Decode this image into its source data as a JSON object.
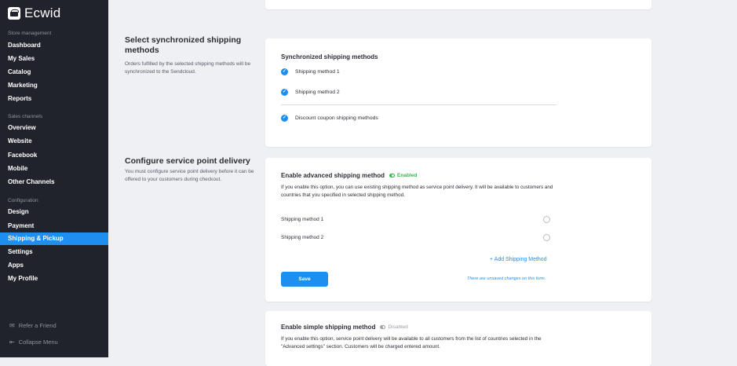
{
  "app": {
    "logo_text": "Ecwid",
    "logo_icon": "ecwid-bag-icon"
  },
  "sidebar": {
    "store_label": "Store management",
    "store_items": [
      "Dashboard",
      "My Sales",
      "Catalog",
      "Marketing",
      "Reports"
    ],
    "channels_label": "Sales channels",
    "channels_items": [
      "Overview",
      "Website",
      "Facebook",
      "Mobile",
      "Other Channels"
    ],
    "config_label": "Configuration",
    "config_items": [
      "Design",
      "Payment",
      "Shipping & Pickup",
      "Settings",
      "Apps",
      "My Profile"
    ],
    "active_item": "Shipping & Pickup",
    "footer": {
      "refer_label": "Refer a Friend",
      "refer_icon": "envelope-icon",
      "collapse_label": "Collapse Menu",
      "collapse_icon": "collapse-arrow-icon"
    }
  },
  "sync_section": {
    "title": "Select synchronized shipping methods",
    "description": "Orders fulfilled by the selected shipping methods will be synchronized to the Sendcloud.",
    "card_title": "Synchronized shipping methods",
    "methods": [
      "Shipping method 1",
      "Shipping method 2"
    ],
    "extra_method": "Discount coupon shipping methods"
  },
  "service_point_section": {
    "title": "Configure service point delivery",
    "description": "You must configure service point delivery before it can be offered to your customers during checkout."
  },
  "advanced_card": {
    "title": "Enable advanced shipping method",
    "status": "Enabled",
    "body": "If you enable this option, you can use existing shipping method as service point delivery. It will be available to customers and countries that you specified in selected shipping method.",
    "methods": [
      "Shipping method 1",
      "Shipping method 2"
    ],
    "add_link": "+ Add Shipping Method",
    "save_label": "Save",
    "unsaved_note": "There are unsaved changes on this form."
  },
  "simple_card": {
    "title": "Enable simple shipping method",
    "status": "Disabled",
    "body": "If you enable this option, service point delivery will be available to all customers from the list of countries selected in the \"Advanced settings\" section. Customers will be charged entered amount."
  },
  "colors": {
    "sidebar_bg": "#20232b",
    "accent": "#1f8ef1",
    "enabled_green": "#3cb34f",
    "page_bg": "#eef0f3"
  }
}
